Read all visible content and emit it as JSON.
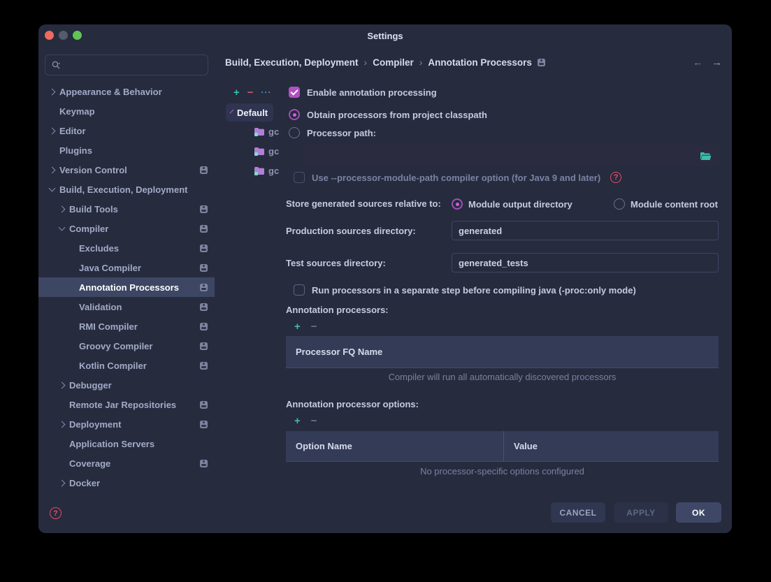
{
  "window": {
    "title": "Settings"
  },
  "sidebar": {
    "search_placeholder": "",
    "items": [
      {
        "label": "Appearance & Behavior",
        "level": 0,
        "chevron": "collapsed",
        "badge": false
      },
      {
        "label": "Keymap",
        "level": 0,
        "chevron": "none",
        "badge": false
      },
      {
        "label": "Editor",
        "level": 0,
        "chevron": "collapsed",
        "badge": false
      },
      {
        "label": "Plugins",
        "level": 0,
        "chevron": "none",
        "badge": false
      },
      {
        "label": "Version Control",
        "level": 0,
        "chevron": "collapsed",
        "badge": true
      },
      {
        "label": "Build, Execution, Deployment",
        "level": 0,
        "chevron": "expanded",
        "badge": false
      },
      {
        "label": "Build Tools",
        "level": 1,
        "chevron": "collapsed",
        "badge": true
      },
      {
        "label": "Compiler",
        "level": 1,
        "chevron": "expanded",
        "badge": true
      },
      {
        "label": "Excludes",
        "level": 2,
        "chevron": "none",
        "badge": true
      },
      {
        "label": "Java Compiler",
        "level": 2,
        "chevron": "none",
        "badge": true
      },
      {
        "label": "Annotation Processors",
        "level": 2,
        "chevron": "none",
        "badge": true,
        "selected": true
      },
      {
        "label": "Validation",
        "level": 2,
        "chevron": "none",
        "badge": true
      },
      {
        "label": "RMI Compiler",
        "level": 2,
        "chevron": "none",
        "badge": true
      },
      {
        "label": "Groovy Compiler",
        "level": 2,
        "chevron": "none",
        "badge": true
      },
      {
        "label": "Kotlin Compiler",
        "level": 2,
        "chevron": "none",
        "badge": true
      },
      {
        "label": "Debugger",
        "level": 1,
        "chevron": "collapsed",
        "badge": false
      },
      {
        "label": "Remote Jar Repositories",
        "level": 1,
        "chevron": "none",
        "badge": true
      },
      {
        "label": "Deployment",
        "level": 1,
        "chevron": "collapsed",
        "badge": true
      },
      {
        "label": "Application Servers",
        "level": 1,
        "chevron": "none",
        "badge": false
      },
      {
        "label": "Coverage",
        "level": 1,
        "chevron": "none",
        "badge": true
      },
      {
        "label": "Docker",
        "level": 1,
        "chevron": "collapsed",
        "badge": false
      }
    ],
    "help_glyph": "?"
  },
  "breadcrumb": {
    "segments": [
      "Build, Execution, Deployment",
      "Compiler",
      "Annotation Processors"
    ]
  },
  "nav": {
    "back_glyph": "←",
    "forward_glyph": "→"
  },
  "profiles": {
    "toolbar": {
      "add": "+",
      "remove": "−",
      "more": "···"
    },
    "root_label": "Default",
    "children": [
      {
        "label": "gc"
      },
      {
        "label": "gc"
      },
      {
        "label": "gc"
      }
    ]
  },
  "form": {
    "enable_checkbox": {
      "label": "Enable annotation processing",
      "checked": true
    },
    "obtain_radio": {
      "label": "Obtain processors from project classpath",
      "selected": true
    },
    "processor_path_radio": {
      "label": "Processor path:",
      "selected": false
    },
    "processor_path_value": "",
    "module_path_checkbox": {
      "label": "Use --processor-module-path compiler option (for Java 9 and later)",
      "checked": false,
      "help_glyph": "?"
    },
    "store_label": "Store generated sources relative to:",
    "store_options": [
      {
        "label": "Module output directory",
        "selected": true
      },
      {
        "label": "Module content root",
        "selected": false
      }
    ],
    "production_label": "Production sources directory:",
    "production_value": "generated",
    "test_label": "Test sources directory:",
    "test_value": "generated_tests",
    "proc_only_checkbox": {
      "label": "Run processors in a separate step before compiling java (-proc:only mode)",
      "checked": false
    },
    "processors_section": {
      "label": "Annotation processors:",
      "add": "+",
      "remove": "−",
      "table_header": "Processor FQ Name",
      "empty_text": "Compiler will run all automatically discovered processors"
    },
    "options_section": {
      "label": "Annotation processor options:",
      "add": "+",
      "remove": "−",
      "columns": [
        "Option Name",
        "Value"
      ],
      "empty_text": "No processor-specific options configured"
    }
  },
  "buttons": {
    "cancel": "CANCEL",
    "apply": "APPLY",
    "ok": "OK"
  },
  "colors": {
    "accent_magenta": "#b14fc4",
    "accent_teal": "#3fbcab",
    "danger_red": "#e84b66",
    "selection": "#3d4663",
    "table_header_bg": "#343b56",
    "window_bg": "#262b3e",
    "ok_button_bg": "#3e4866"
  }
}
